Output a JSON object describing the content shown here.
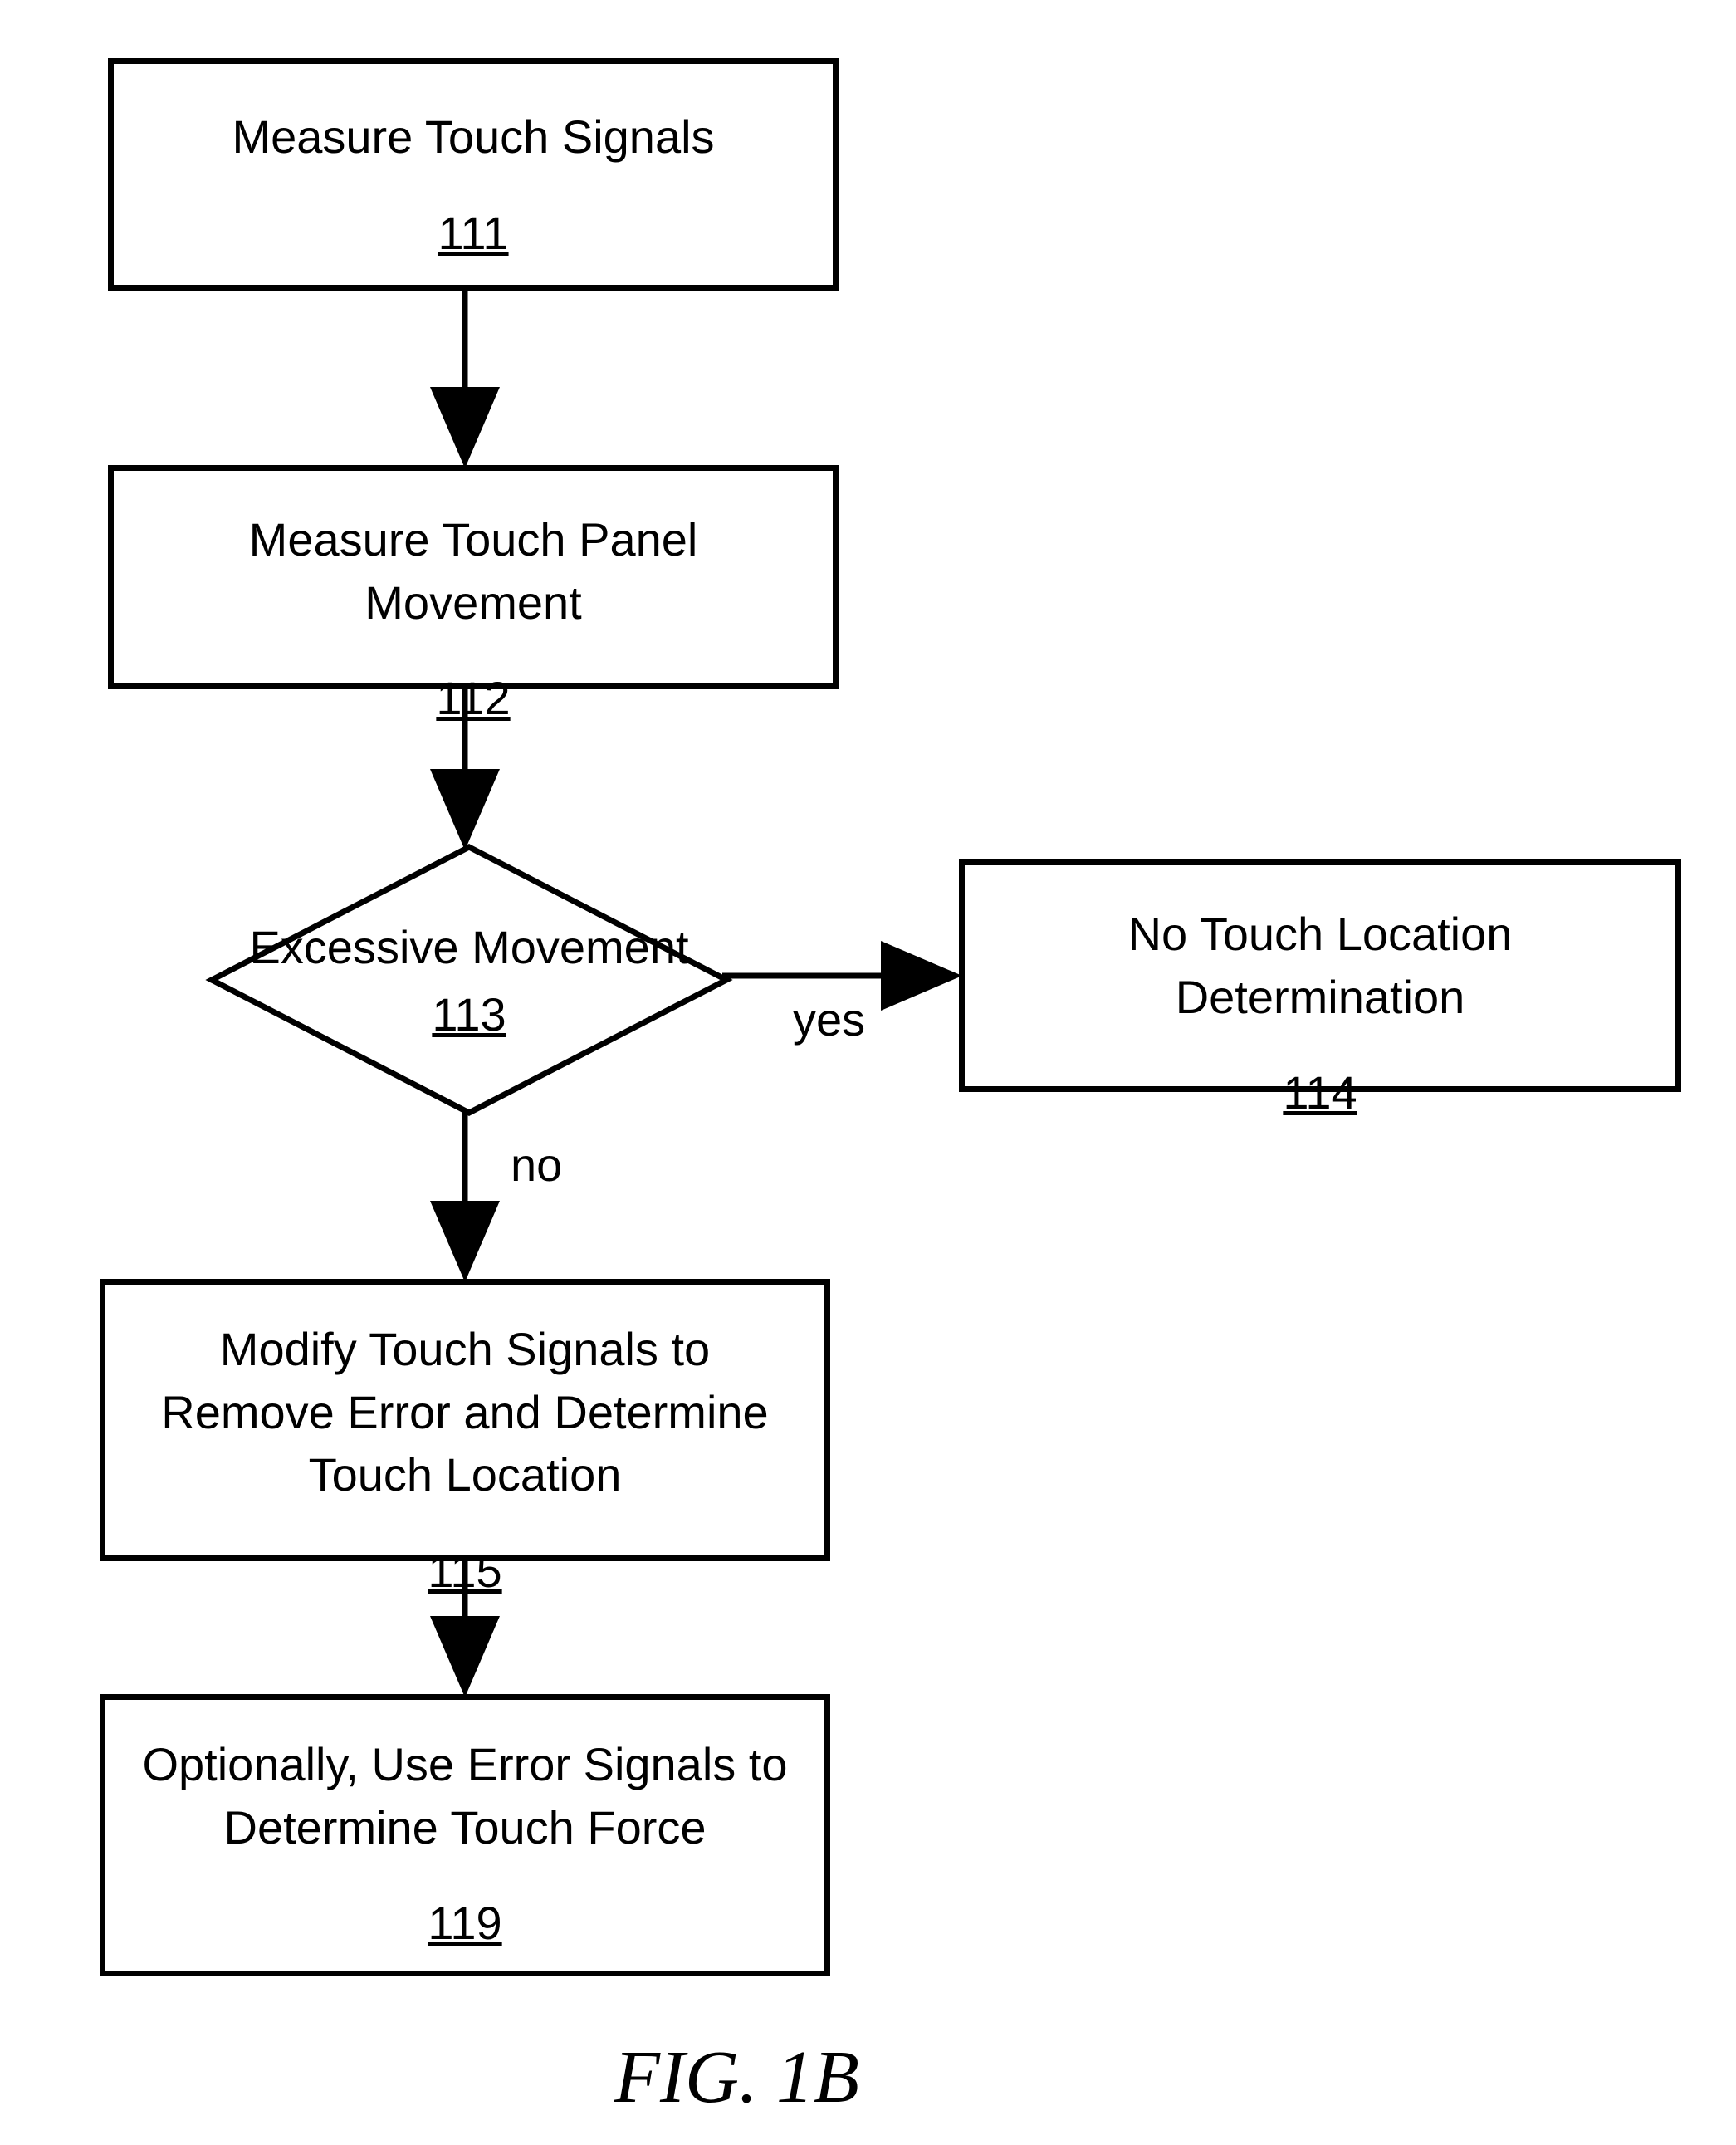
{
  "nodes": {
    "n111": {
      "title": "Measure Touch Signals",
      "num": "111"
    },
    "n112": {
      "title": "Measure Touch Panel Movement",
      "num": "112"
    },
    "n113": {
      "title": "Excessive Movement",
      "num": "113"
    },
    "n114": {
      "title": "No Touch Location Determination",
      "num": "114"
    },
    "n115": {
      "title": "Modify Touch Signals to Remove Error and Determine Touch Location",
      "num": "115"
    },
    "n119": {
      "title": "Optionally, Use Error Signals to Determine Touch Force",
      "num": "119"
    }
  },
  "edges": {
    "e113yes": "yes",
    "e113no": "no"
  },
  "caption": "FIG. 1B"
}
